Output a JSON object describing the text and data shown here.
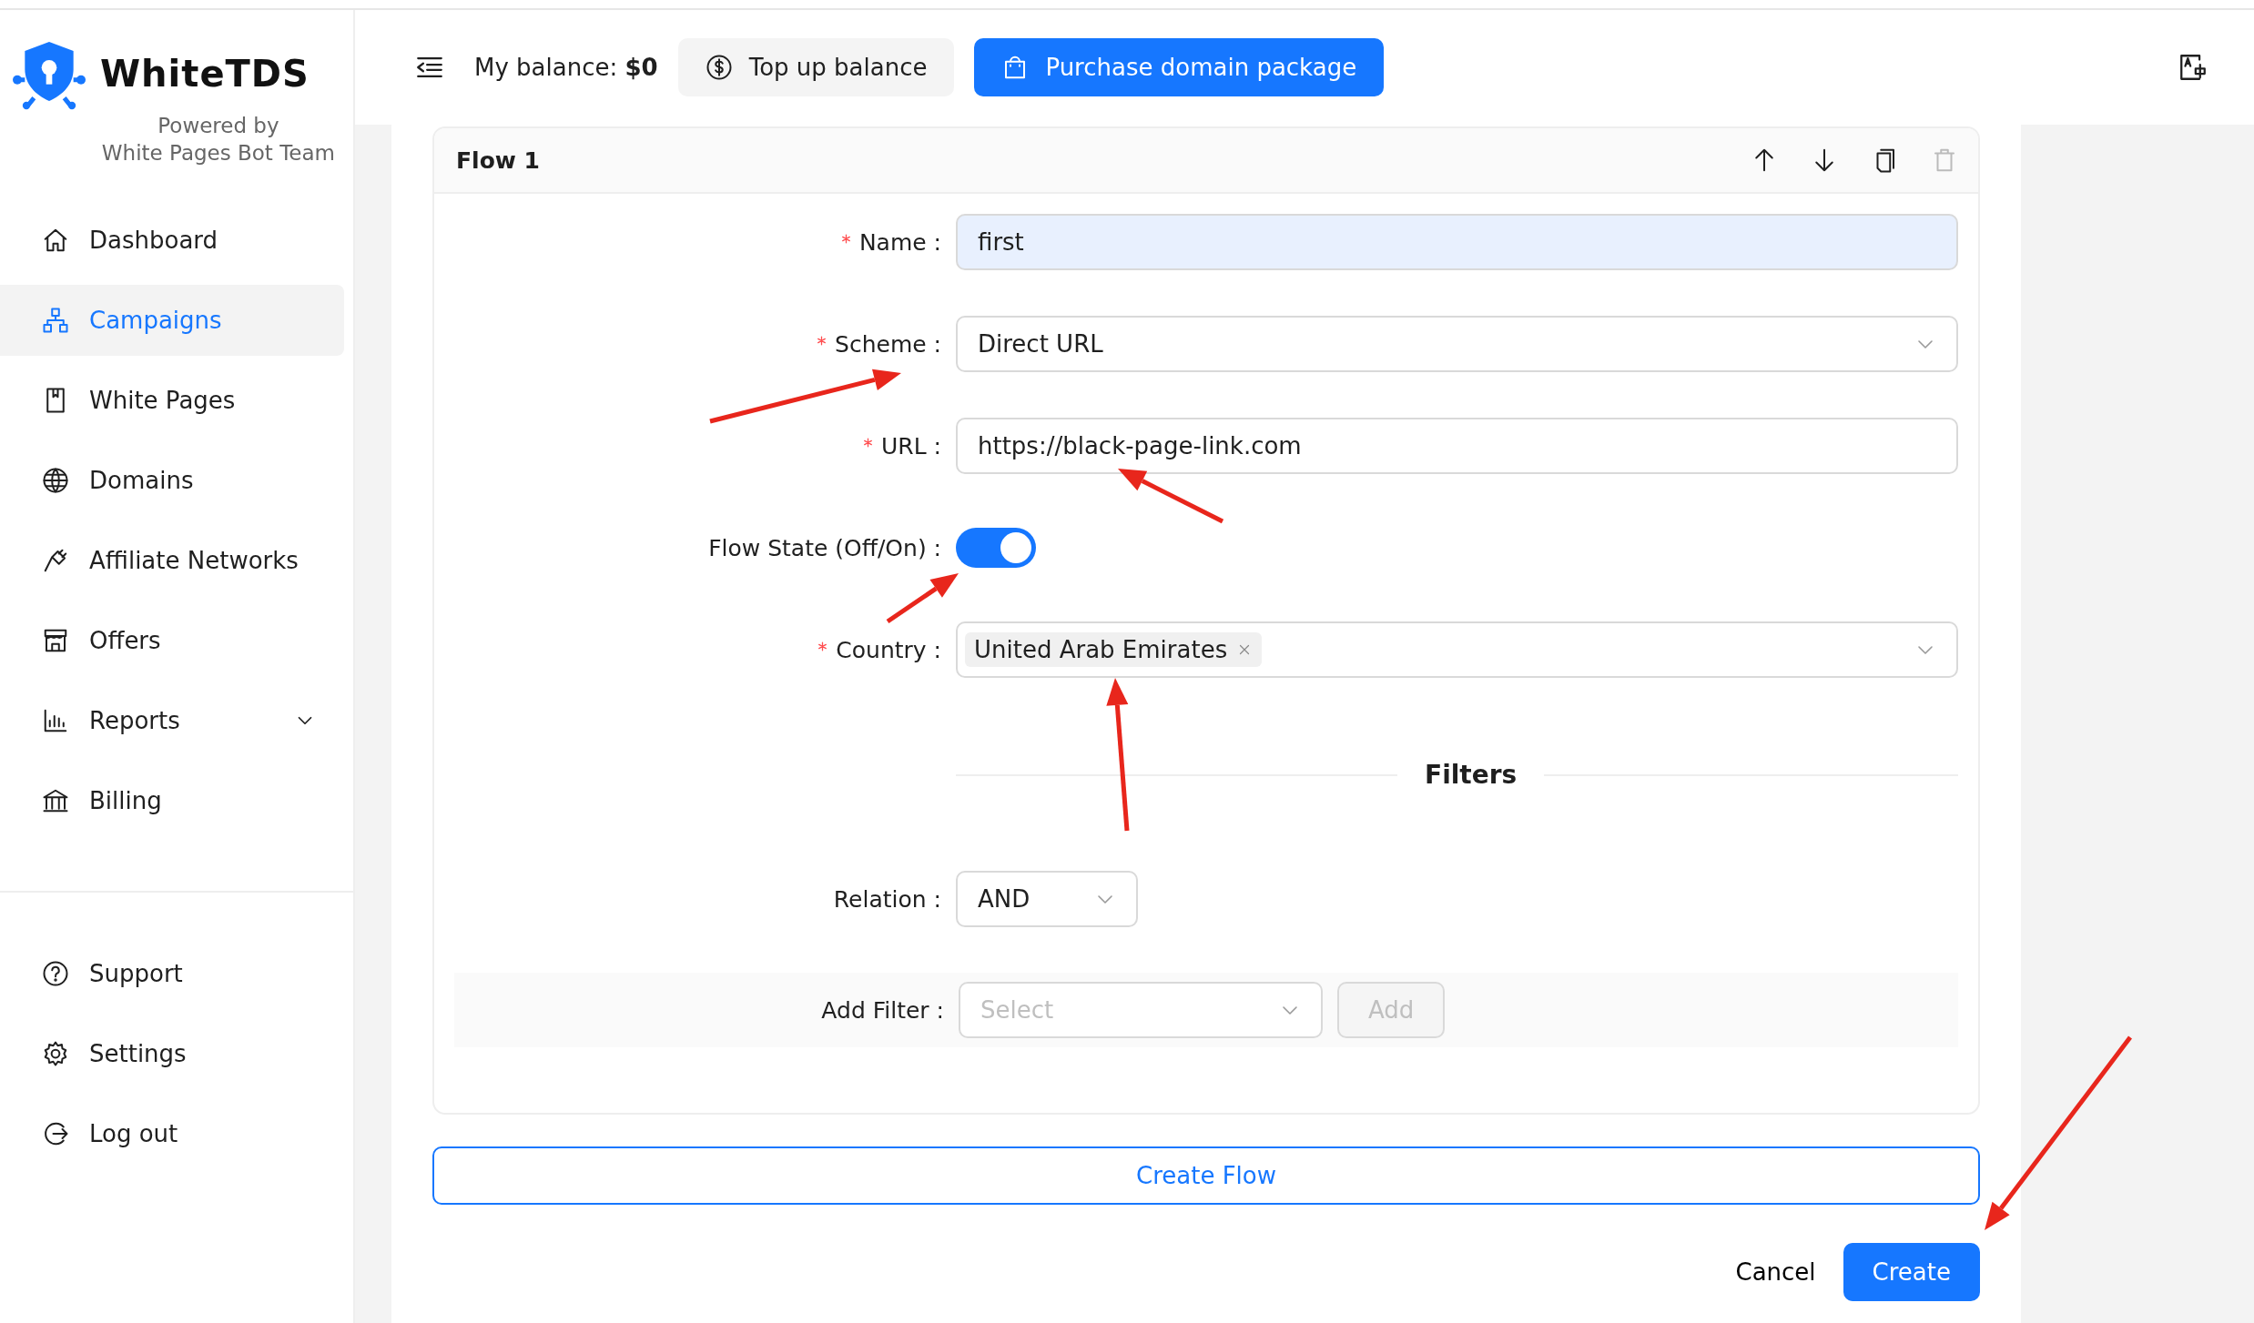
{
  "brand": {
    "name": "WhiteTDS",
    "tagline": "Powered by\nWhite Pages Bot Team"
  },
  "sidebar": {
    "items": [
      {
        "label": "Dashboard",
        "selected": false
      },
      {
        "label": "Campaigns",
        "selected": true
      },
      {
        "label": "White Pages",
        "selected": false
      },
      {
        "label": "Domains",
        "selected": false
      },
      {
        "label": "Affiliate Networks",
        "selected": false
      },
      {
        "label": "Offers",
        "selected": false
      },
      {
        "label": "Reports",
        "selected": false,
        "expanded": false
      },
      {
        "label": "Billing",
        "selected": false
      }
    ],
    "bottom_items": [
      {
        "label": "Support",
        "selected": false
      },
      {
        "label": "Settings",
        "selected": false
      },
      {
        "label": "Log out",
        "selected": false
      }
    ]
  },
  "header": {
    "balance_label": "My balance: **$0**",
    "top_up": "Top up balance",
    "purchase": "Purchase domain package"
  },
  "flow": {
    "title": "Flow 1",
    "delete_disabled": true,
    "fields": [
      {
        "kind": "text",
        "label": "Name :",
        "required": true,
        "value": "first",
        "focused": true
      },
      {
        "kind": "select",
        "label": "Scheme :",
        "required": true,
        "value": "Direct URL"
      },
      {
        "kind": "text",
        "label": "URL :",
        "required": true,
        "value": "https://black-page-link.com",
        "focused": false
      },
      {
        "kind": "switch",
        "label": "Flow State (Off/On) :",
        "required": false,
        "on": true
      },
      {
        "kind": "tags",
        "label": "Country :",
        "required": true,
        "tags": [
          "United Arab Emirates"
        ]
      }
    ],
    "filters_title": "Filters",
    "relation": {
      "label": "Relation :",
      "value": "AND"
    },
    "add_filter": {
      "label": "Add Filter :",
      "placeholder": "Select",
      "button": "Add",
      "button_disabled": true
    }
  },
  "create_flow": "Create Flow",
  "footer": {
    "cancel": "Cancel",
    "create": "Create"
  }
}
